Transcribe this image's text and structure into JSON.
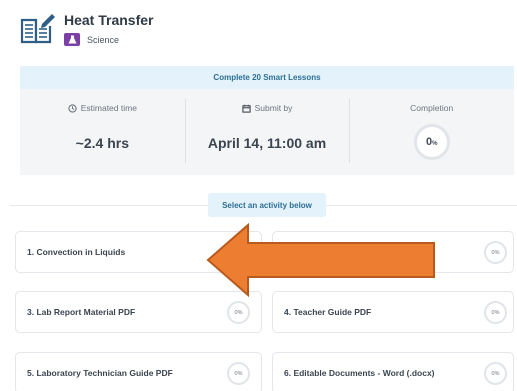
{
  "lesson": {
    "title": "Heat Transfer",
    "subject": "Science"
  },
  "summary": {
    "banner": "Complete 20 Smart Lessons",
    "estimated_label": "Estimated time",
    "estimated_value": "~2.4 hrs",
    "submit_label": "Submit by",
    "submit_value": "April 14, 11:00 am",
    "completion_label": "Completion",
    "completion_number": "0",
    "completion_unit": "%"
  },
  "select_label": "Select an activity below",
  "activities": [
    {
      "label": "1. Convection in Liquids",
      "progress": ""
    },
    {
      "label": "",
      "progress": "0%"
    },
    {
      "label": "3. Lab Report Material PDF",
      "progress": "0%"
    },
    {
      "label": "4. Teacher Guide PDF",
      "progress": "0%"
    },
    {
      "label": "5. Laboratory Technician Guide PDF",
      "progress": "0%"
    },
    {
      "label": "6. Editable Documents - Word (.docx)",
      "progress": "0%"
    }
  ],
  "icons": {
    "lesson": "book-edit-icon",
    "subject": "flask-icon",
    "estimated": "clock-icon",
    "submit": "calendar-icon",
    "pointer": "arrow-left-icon"
  },
  "colors": {
    "accent_banner": "#e3f2fb",
    "accent_text": "#2d6f94",
    "subject_badge": "#7b3fa6",
    "arrow_fill": "#ed7d31",
    "arrow_stroke": "#b85a1c"
  }
}
